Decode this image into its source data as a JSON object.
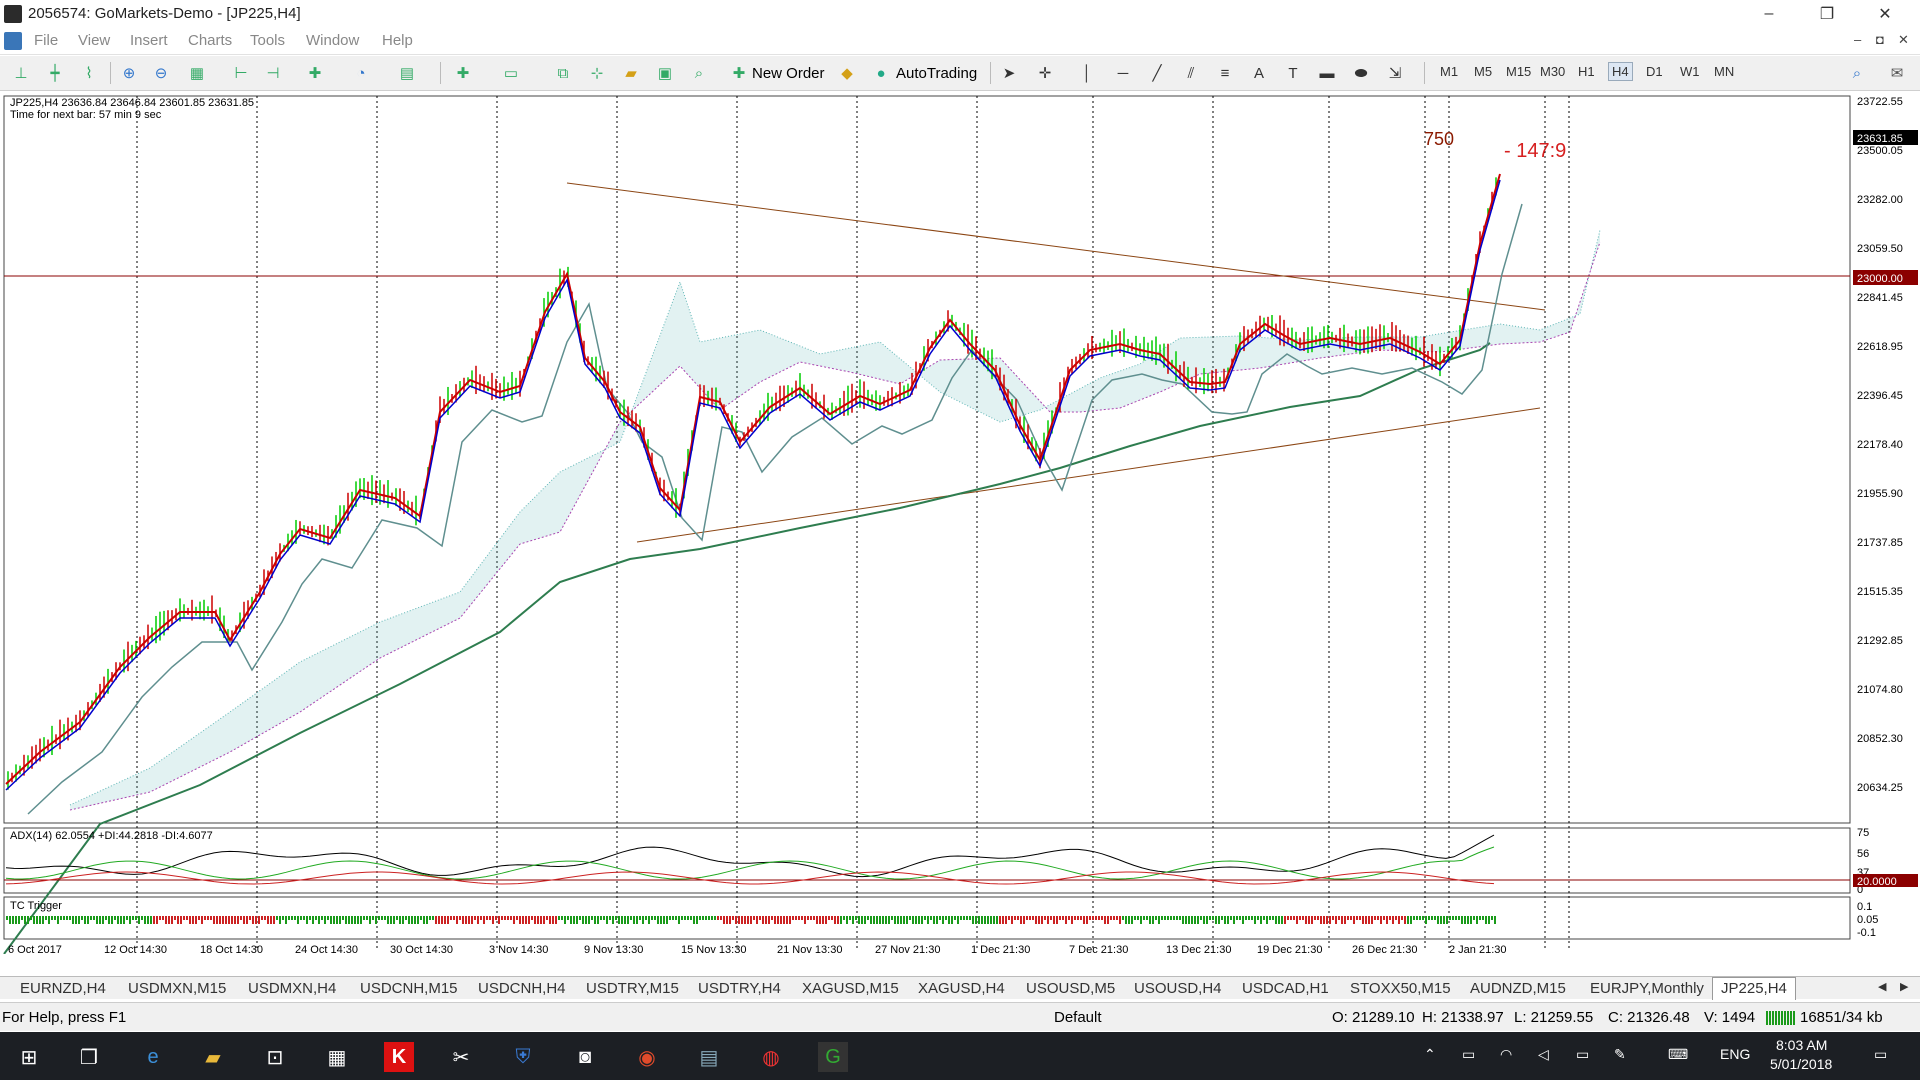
{
  "window": {
    "title": "2056574: GoMarkets-Demo - [JP225,H4]",
    "minimize": "–",
    "maximize": "❐",
    "close": "✕"
  },
  "menu": [
    "File",
    "View",
    "Insert",
    "Charts",
    "Tools",
    "Window",
    "Help"
  ],
  "mdi_controls": [
    "–",
    "◘",
    "✕"
  ],
  "toolbar": {
    "new_order": "New Order",
    "autotrading": "AutoTrading",
    "timeframes": [
      "M1",
      "M5",
      "M15",
      "M30",
      "H1",
      "H4",
      "D1",
      "W1",
      "MN"
    ],
    "active_timeframe": "H4"
  },
  "chart": {
    "header_line1": "JP225,H4  23636.84 23646.84 23601.85 23631.85",
    "header_line2": "Time for next bar: 57 min 9 sec",
    "annotation_750": "750",
    "annotation_147": "- 147:9",
    "price_axis": [
      "23722.55",
      "23500.05",
      "23282.00",
      "23059.50",
      "22841.45",
      "22618.95",
      "22396.45",
      "22178.40",
      "21955.90",
      "21737.85",
      "21515.35",
      "21292.85",
      "21074.80",
      "20852.30",
      "20634.25"
    ],
    "current_price": "23631.85",
    "level_price": "23000.00",
    "time_axis": [
      "6 Oct 2017",
      "12 Oct 14:30",
      "18 Oct 14:30",
      "24 Oct 14:30",
      "30 Oct 14:30",
      "3 Nov 14:30",
      "9 Nov 13:30",
      "15 Nov 13:30",
      "21 Nov 13:30",
      "27 Nov 21:30",
      "1 Dec 21:30",
      "7 Dec 21:30",
      "13 Dec 21:30",
      "19 Dec 21:30",
      "26 Dec 21:30",
      "2 Jan 21:30"
    ],
    "adx_label": "ADX(14) 62.0554 +DI:44.2818 -DI:4.6077",
    "adx_axis": [
      "75",
      "56",
      "37",
      "0"
    ],
    "adx_level": "20.0000",
    "tc_label": "TC Trigger",
    "tc_axis": [
      "0.1",
      "0.05",
      "-0.1"
    ]
  },
  "tabs": [
    "EURNZD,H4",
    "USDMXN,M15",
    "USDMXN,H4",
    "USDCNH,M15",
    "USDCNH,H4",
    "USDTRY,M15",
    "USDTRY,H4",
    "XAGUSD,M15",
    "XAGUSD,H4",
    "USOUSD,M5",
    "USOUSD,H4",
    "USDCAD,H1",
    "STOXX50,M15",
    "AUDNZD,M15",
    "EURJPY,Monthly",
    "JP225,H4"
  ],
  "status": {
    "help": "For Help, press F1",
    "profile": "Default",
    "open": "O: 21289.10",
    "high": "H: 21338.97",
    "low": "L: 21259.55",
    "close": "C: 21326.48",
    "volume": "V: 1494",
    "traffic": "16851/34 kb"
  },
  "taskbar": {
    "lang": "ENG",
    "time": "8:03 AM",
    "date": "5/01/2018"
  },
  "colors": {
    "price_line": "#cc0000",
    "ma_fast": "#0000cc",
    "ma_slow": "#2e8b57",
    "trend": "#8b4513",
    "cloud_a": "#5fb6b6",
    "cloud_b": "#b03cb0"
  }
}
